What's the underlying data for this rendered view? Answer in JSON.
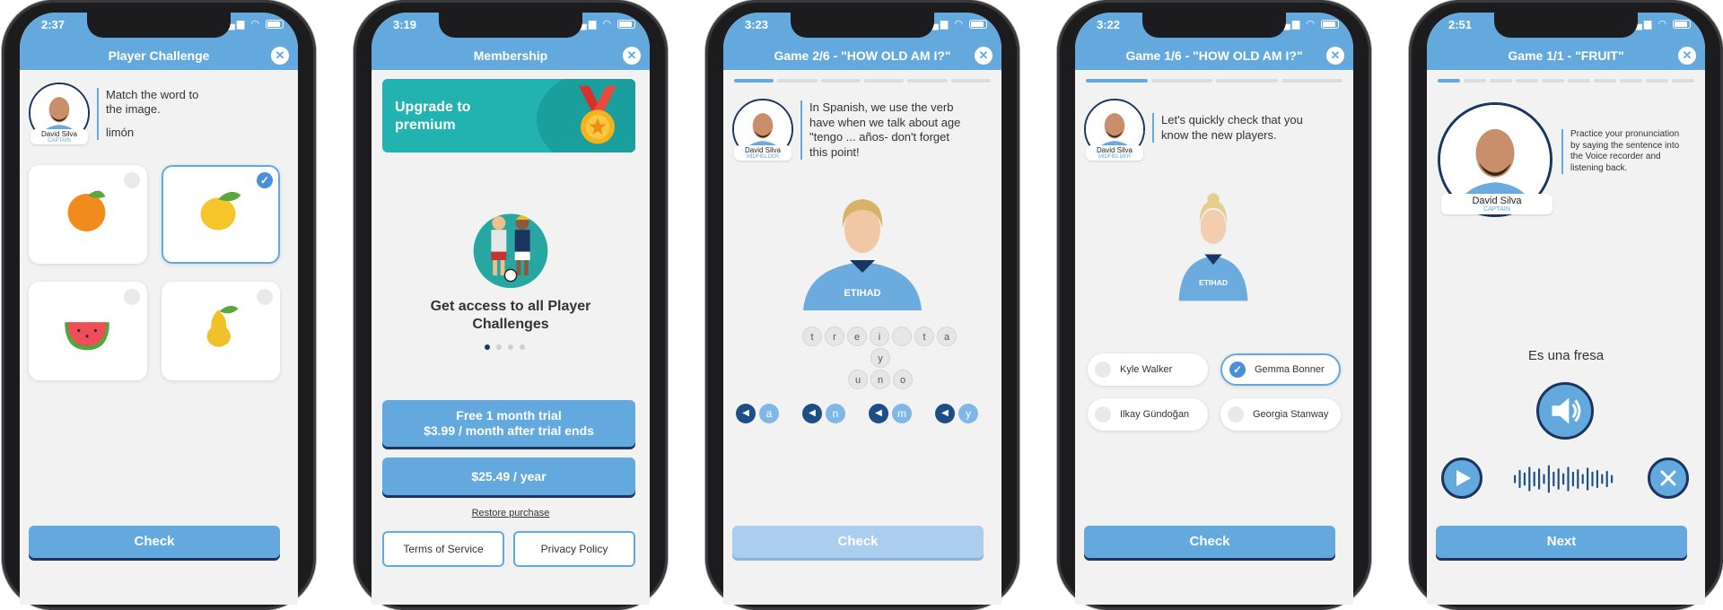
{
  "colors": {
    "primary": "#64a9dd",
    "navy": "#1b3561",
    "teal": "#22b3b0"
  },
  "coach": {
    "name": "David Silva",
    "role_captain": "CAPTAIN",
    "role_midfielder": "MIDFIELDER"
  },
  "screen1": {
    "time": "2:37",
    "title": "Player Challenge",
    "prompt_line": "Match the word to the image.",
    "word": "limón",
    "options": [
      {
        "icon": "orange-icon",
        "selected": false
      },
      {
        "icon": "lemon-icon",
        "selected": true
      },
      {
        "icon": "watermelon-icon",
        "selected": false
      },
      {
        "icon": "pear-icon",
        "selected": false
      }
    ],
    "check_label": "Check"
  },
  "screen2": {
    "time": "3:19",
    "title": "Membership",
    "banner_text": "Upgrade to premium",
    "headline": "Get access to all Player Challenges",
    "dots": 4,
    "active_dot": 0,
    "trial_line1": "Free 1 month trial",
    "trial_line2": "$3.99 / month after trial ends",
    "yearly_label": "$25.49 / year",
    "restore_label": "Restore purchase",
    "terms_label": "Terms of Service",
    "privacy_label": "Privacy Policy"
  },
  "screen3": {
    "time": "3:23",
    "title": "Game 2/6 - \"HOW OLD AM I?\"",
    "progress_total": 6,
    "progress_done": 1,
    "speech": "In Spanish, we use the verb have when we talk about age \"tengo ... años- don't forget this point!",
    "tiles_row1": [
      "t",
      "r",
      "e",
      "i",
      "",
      "t",
      "a"
    ],
    "tiles_row2": [
      "y"
    ],
    "tiles_row3": [
      "u",
      "n",
      "o"
    ],
    "letters": [
      "a",
      "n",
      "m",
      "y"
    ],
    "shirt_text": "ETIHAD",
    "check_label": "Check"
  },
  "screen4": {
    "time": "3:22",
    "title": "Game 1/6 - \"HOW OLD AM I?\"",
    "progress_total": 4,
    "progress_done": 1,
    "speech": "Let's quickly check that you know the new players.",
    "choices": [
      {
        "label": "Kyle Walker",
        "selected": false
      },
      {
        "label": "Gemma Bonner",
        "selected": true
      },
      {
        "label": "Ilkay Gündoğan",
        "selected": false
      },
      {
        "label": "Georgia Stanway",
        "selected": false
      }
    ],
    "shirt_text": "ETIHAD",
    "check_label": "Check"
  },
  "screen5": {
    "time": "2:51",
    "title": "Game 1/1 - \"FRUIT\"",
    "progress_total": 10,
    "progress_done": 1,
    "speech": "Practice your pronunciation by saying the sentence into the Voice recorder and listening back.",
    "sentence": "Es una fresa",
    "next_label": "Next"
  }
}
